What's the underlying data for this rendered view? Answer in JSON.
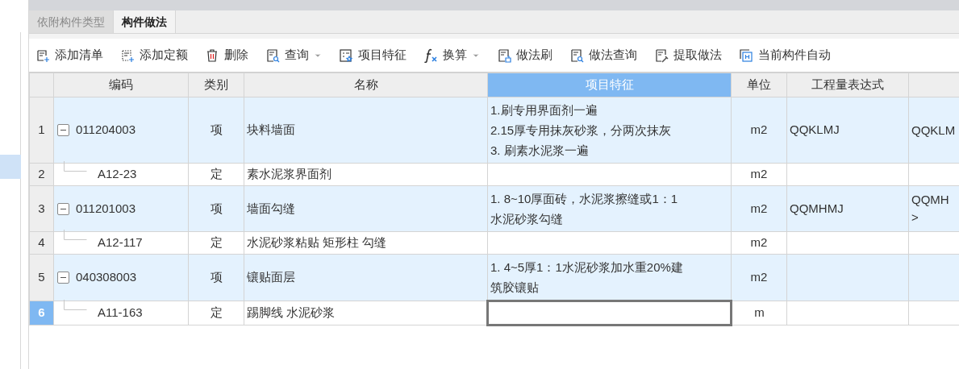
{
  "tabs": [
    {
      "label": "依附构件类型",
      "selected": false
    },
    {
      "label": "构件做法",
      "selected": true
    }
  ],
  "toolbar": [
    {
      "label": "添加清单",
      "dropdown": false
    },
    {
      "label": "添加定额",
      "dropdown": false
    },
    {
      "label": "删除",
      "dropdown": false
    },
    {
      "label": "查询",
      "dropdown": true
    },
    {
      "label": "项目特征",
      "dropdown": false
    },
    {
      "label": "换算",
      "dropdown": true
    },
    {
      "label": "做法刷",
      "dropdown": false
    },
    {
      "label": "做法查询",
      "dropdown": false
    },
    {
      "label": "提取做法",
      "dropdown": false
    },
    {
      "label": "当前构件自动",
      "dropdown": false
    }
  ],
  "table": {
    "columns": [
      {
        "label": "编码",
        "selected": false
      },
      {
        "label": "类别",
        "selected": false
      },
      {
        "label": "名称",
        "selected": false
      },
      {
        "label": "项目特征",
        "selected": true
      },
      {
        "label": "单位",
        "selected": false
      },
      {
        "label": "工程量表达式",
        "selected": false
      },
      {
        "selected": false
      }
    ],
    "rows": [
      {
        "number": "1",
        "kind": "item",
        "expanded": true,
        "selected": false,
        "code": "011204003",
        "type": "项",
        "name": "块料墙面",
        "feature_lines": [
          "1.刷专用界面剂一遍",
          "2.15厚专用抹灰砂浆，分两次抹灰",
          "3. 刷素水泥浆一遍"
        ],
        "unit": "m2",
        "expression": "QQKLMJ",
        "column_8": [
          "QQKLM"
        ]
      },
      {
        "number": "2",
        "kind": "quota",
        "selected": false,
        "code": "A12-23",
        "type": "定",
        "name": "素水泥浆界面剂",
        "feature_lines": [],
        "unit": "m2",
        "expression": "",
        "column_8": []
      },
      {
        "number": "3",
        "kind": "item",
        "expanded": true,
        "selected": false,
        "code": "011201003",
        "type": "项",
        "name": "墙面勾缝",
        "feature_lines": [
          "1. 8~10厚面砖，水泥浆擦缝或1：1",
          "水泥砂浆勾缝"
        ],
        "unit": "m2",
        "expression": "QQMHMJ",
        "column_8": [
          "QQMH",
          ">"
        ]
      },
      {
        "number": "4",
        "kind": "quota",
        "selected": false,
        "code": "A12-117",
        "type": "定",
        "name": "水泥砂浆粘贴 矩形柱 勾缝",
        "feature_lines": [],
        "unit": "m2",
        "expression": "",
        "column_8": []
      },
      {
        "number": "5",
        "kind": "item",
        "expanded": true,
        "selected": false,
        "code": "040308003",
        "type": "项",
        "name": "镶贴面层",
        "feature_lines": [
          "1. 4~5厚1：1水泥砂浆加水重20%建",
          "筑胶镶贴"
        ],
        "unit": "m2",
        "expression": "",
        "column_8": []
      },
      {
        "number": "6",
        "kind": "quota",
        "selected": true,
        "code": "A11-163",
        "type": "定",
        "name": "踢脚线 水泥砂浆",
        "feature_lines": [],
        "unit": "m",
        "expression": "",
        "column_8": []
      }
    ]
  }
}
